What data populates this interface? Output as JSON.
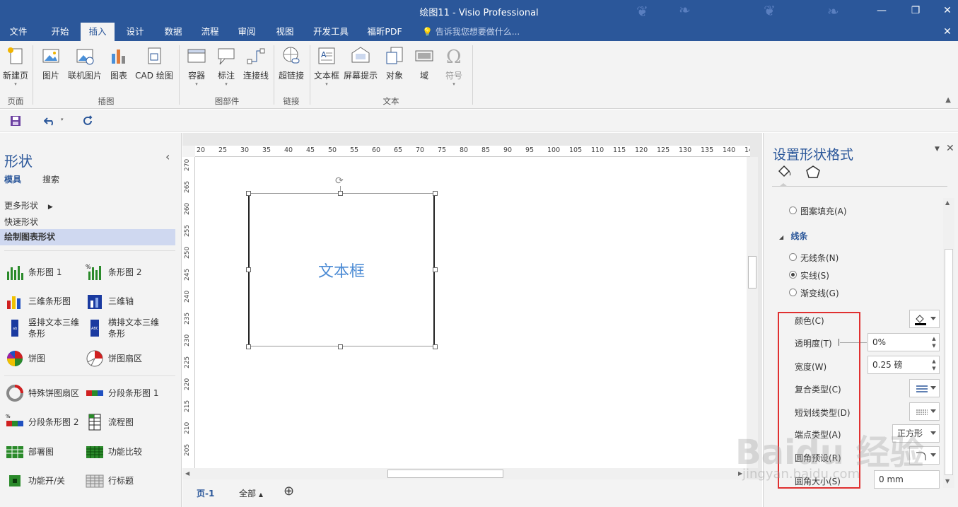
{
  "window": {
    "title": "绘图11 - Visio Professional",
    "min": "—",
    "restore": "❐",
    "close": "✕",
    "close_doc": "✕"
  },
  "menu": {
    "tabs": [
      "文件",
      "开始",
      "插入",
      "设计",
      "数据",
      "流程",
      "审阅",
      "视图",
      "开发工具",
      "福昕PDF"
    ],
    "active": "插入",
    "tellme": "告诉我您想要做什么..."
  },
  "ribbon": {
    "buttons": {
      "new_page": "新建页",
      "picture": "图片",
      "online_picture": "联机图片",
      "chart": "图表",
      "cad": "CAD 绘图",
      "container": "容器",
      "callout": "标注",
      "connector": "连接线",
      "hyperlink": "超链接",
      "textbox": "文本框",
      "screentip": "屏幕提示",
      "object": "对象",
      "field": "域",
      "symbol": "符号"
    },
    "groups": {
      "pages": "页面",
      "illustrations": "插图",
      "diagram_parts": "图部件",
      "links": "链接",
      "text": "文本"
    }
  },
  "shapes": {
    "title": "形状",
    "collapse": "‹",
    "nav_stencils": "模具",
    "nav_search": "搜索",
    "more_shapes": "更多形状",
    "quick_shapes": "快速形状",
    "selected_stencil": "绘制图表形状",
    "items": [
      {
        "label": "条形图 1"
      },
      {
        "label": "条形图 2"
      },
      {
        "label": "三维条形图"
      },
      {
        "label": "三维轴"
      },
      {
        "label": "竖排文本三维条形"
      },
      {
        "label": "横排文本三维条形"
      },
      {
        "label": "饼图"
      },
      {
        "label": "饼图扇区"
      },
      {
        "label": "特殊饼图扇区"
      },
      {
        "label": "分段条形图 1"
      },
      {
        "label": "分段条形图 2"
      },
      {
        "label": "流程图"
      },
      {
        "label": "部署图"
      },
      {
        "label": "功能比较"
      },
      {
        "label": "功能开/关"
      },
      {
        "label": "行标题"
      }
    ]
  },
  "canvas": {
    "hruler": [
      "20",
      "25",
      "30",
      "35",
      "40",
      "45",
      "50",
      "55",
      "60",
      "65",
      "70",
      "75",
      "80",
      "85",
      "90",
      "95",
      "100",
      "105",
      "110",
      "115",
      "120",
      "125",
      "130",
      "135",
      "140",
      "14"
    ],
    "vruler": [
      "270",
      "265",
      "260",
      "255",
      "250",
      "245",
      "240",
      "235",
      "230",
      "225",
      "220",
      "215",
      "210",
      "205"
    ],
    "textbox_text": "文本框",
    "page_tab": "页-1",
    "all_tab": "全部",
    "add_page": "⊕"
  },
  "format": {
    "title": "设置形状格式",
    "pattern_fill": "图案填充(A)",
    "line_section": "线条",
    "no_line": "无线条(N)",
    "solid_line": "实线(S)",
    "gradient_line": "渐变线(G)",
    "color_label": "颜色(C)",
    "transparency_label": "透明度(T)",
    "transparency_value": "0%",
    "width_label": "宽度(W)",
    "width_value": "0.25 磅",
    "compound_label": "复合类型(C)",
    "dash_label": "短划线类型(D)",
    "cap_label": "端点类型(A)",
    "cap_value": "正方形",
    "round_label": "圆角预设(R)",
    "round_size_label": "圆角大小(S)",
    "round_size_value": "0 mm"
  },
  "watermark": {
    "brand": "Baidu 经验",
    "url": "jingyan.baidu.com"
  }
}
